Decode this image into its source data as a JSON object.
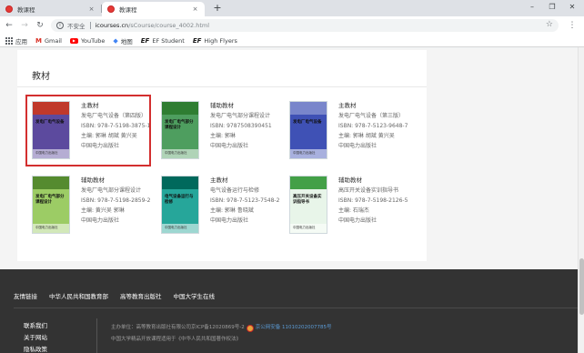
{
  "browser": {
    "tabs": [
      {
        "title": "教课程",
        "close": "×"
      },
      {
        "title": "教课程",
        "close": "×"
      }
    ],
    "new_tab": "+",
    "window_controls": {
      "minimize": "–",
      "maximize": "❐",
      "close": "✕"
    },
    "nav": {
      "back": "←",
      "forward": "→",
      "reload": "↻"
    },
    "address": {
      "security_label": "不安全",
      "host": "icourses.cn",
      "path": "/sCourse/course_4002.html"
    },
    "menu": "⋮",
    "star": "☆"
  },
  "bookmarks": [
    {
      "label": "应用",
      "icon": "apps-grid-icon"
    },
    {
      "label": "Gmail",
      "icon": "gmail-icon"
    },
    {
      "label": "YouTube",
      "icon": "youtube-icon"
    },
    {
      "label": "地图",
      "icon": "map-icon"
    },
    {
      "label": "EF Student",
      "icon": "ef-icon"
    },
    {
      "label": "High Flyers",
      "icon": "ef-icon"
    }
  ],
  "textbooks": {
    "heading": "教材",
    "books": [
      {
        "type": "主教材",
        "title": "发电厂电气设备（第四版）",
        "isbn": "ISBN: 978-7-5198-3875-1",
        "editors": "主编: 郭琳 胡斌 黄兴吴",
        "publisher": "中国电力出版社",
        "cover": {
          "title": "发电厂电气设备",
          "bg": "#5c4a9e",
          "band": "#c0392b"
        }
      },
      {
        "type": "辅助教材",
        "title": "发电厂电气部分课程设计",
        "isbn": "ISBN: 9787508390451",
        "editors": "主编: 郭琳",
        "publisher": "中国电力出版社",
        "cover": {
          "title": "发电厂电气部分课程设计",
          "bg": "#4e9e5f",
          "band": "#2e7d32"
        }
      },
      {
        "type": "主教材",
        "title": "发电厂电气设备（第三版）",
        "isbn": "ISBN: 978-7-5123-9648-7",
        "editors": "主编: 郭琳 胡斌 黄兴吴",
        "publisher": "中国电力出版社",
        "cover": {
          "title": "发电厂电气设备",
          "bg": "#3f51b5",
          "band": "#7986cb"
        }
      },
      {
        "type": "辅助教材",
        "title": "发电厂电气部分课程设计",
        "isbn": "ISBN: 978-7-5198-2859-2",
        "editors": "主编: 黄兴吴 郭琳",
        "publisher": "中国电力出版社",
        "cover": {
          "title": "发电厂电气部分课程设计",
          "bg": "#9ccc65",
          "band": "#558b2f"
        }
      },
      {
        "type": "主教材",
        "title": "电气设备运行与检修",
        "isbn": "ISBN: 978-7-5123-7548-2",
        "editors": "主编: 郭琳 鲁晓斌",
        "publisher": "中国电力出版社",
        "cover": {
          "title": "电气设备运行与检修",
          "bg": "#26a69a",
          "band": "#00695c"
        }
      },
      {
        "type": "辅助教材",
        "title": "高压开关设备实训指导书",
        "isbn": "ISBN: 978-7-5198-2126-5",
        "editors": "主编: 石瑞杰",
        "publisher": "中国电力出版社",
        "cover": {
          "title": "高压开关设备实训指导书",
          "bg": "#e8f5e9",
          "band": "#43a047"
        }
      }
    ]
  },
  "footer": {
    "friend_links_label": "友情链接",
    "friend_links": [
      "中华人民共和国教育部",
      "高等教育出版社",
      "中国大学生在线"
    ],
    "nav": [
      "联系我们",
      "关于网站",
      "隐私政策"
    ],
    "host_info": "主办单位：高等教育出版社有限公司京ICP备12020869号-2",
    "police_record": "京公网安备 11010202007785号",
    "course_note": "中国大学精品开放课程适用于《中华人民共和国著作权法》"
  }
}
